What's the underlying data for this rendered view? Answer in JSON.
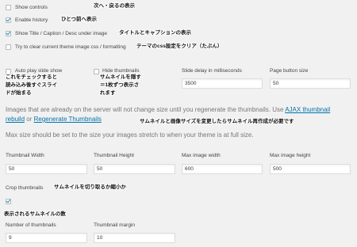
{
  "options": [
    {
      "label": "Show controls",
      "checked": false,
      "note": "次へ・戻るの表示"
    },
    {
      "label": "Enable history",
      "checked": true,
      "note": "ひとつ前へ表示"
    },
    {
      "label": "Show Title / Caption / Desc under image",
      "checked": true,
      "note": "タイトルとキャプションの表示"
    },
    {
      "label": "Try to clear current theme image css / formatting",
      "checked": false,
      "note": "テーマのcss設定をクリア（たぶん）"
    }
  ],
  "row2": {
    "autoplay": {
      "label": "Auto play slide show",
      "checked": false,
      "note_lines": [
        "これをチェックすると",
        "読み込み後すぐスライ",
        "ドが始まる"
      ]
    },
    "hide_thumbs": {
      "label": "Hide thumbnails",
      "checked": false,
      "note_lines": [
        "サムネイルを隠す",
        "＝1枚ずつ表示さ",
        "れます"
      ]
    },
    "slide_delay": {
      "label": "Slide delay in milliseconds",
      "value": "3500"
    },
    "page_button": {
      "label": "Page button size",
      "value": "50"
    }
  },
  "notice": {
    "line1_prefix": "Images that are already on the server will not change size until you regenerate the thumbnails. Use",
    "link1": "AJAX thumbnail",
    "link1b": "rebuild",
    "or": "or",
    "link2": "Regenerate Thumbnails",
    "note": "サムネイルと画像サイズを変更したらサムネイル再作成が必要です"
  },
  "max_note": "Max size should be set to the size your images stretch to when your theme is at full size.",
  "sizes": [
    {
      "label": "Thumbnail Width",
      "value": "50"
    },
    {
      "label": "Thumbnail Height",
      "value": "50"
    },
    {
      "label": "Max image width",
      "value": "600"
    },
    {
      "label": "Max image height",
      "value": "500"
    }
  ],
  "crop": {
    "label": "Crop thumbnails",
    "checked": true,
    "note": "サムネイルを切り取るか縮小か"
  },
  "count_note": "表示されるサムネイルの数",
  "thumbs": [
    {
      "label": "Number of thumbnails",
      "value": "9"
    },
    {
      "label": "Thumbnail margin",
      "value": "10"
    }
  ],
  "colors": {
    "background": "#f1f1f1",
    "link": "#0073aa",
    "check": "#1e8cbe"
  }
}
